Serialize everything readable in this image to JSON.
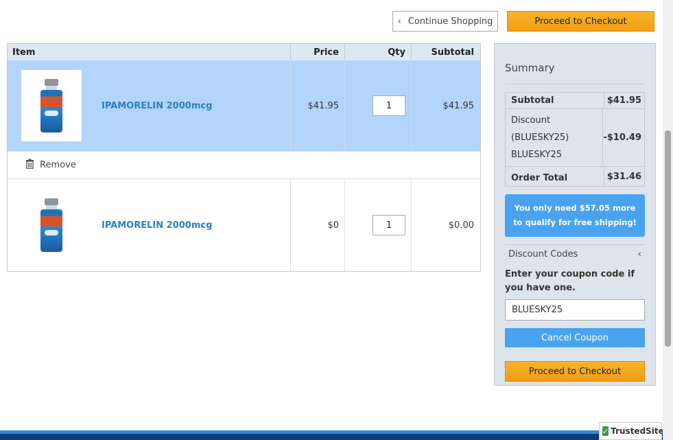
{
  "top": {
    "continue_label": "Continue Shopping",
    "checkout_label": "Proceed to Checkout"
  },
  "cart": {
    "headers": {
      "item": "Item",
      "price": "Price",
      "qty": "Qty",
      "subtotal": "Subtotal"
    },
    "rows": [
      {
        "name": "IPAMORELIN 2000mcg",
        "price": "$41.95",
        "qty": "1",
        "subtotal": "$41.95"
      },
      {
        "name": "IPAMORELIN 2000mcg",
        "price": "$0",
        "qty": "1",
        "subtotal": "$0.00"
      }
    ],
    "remove_label": "Remove"
  },
  "summary": {
    "title": "Summary",
    "subtotal_label": "Subtotal",
    "subtotal_value": "$41.95",
    "discount_label": "Discount (BLUESKY25)",
    "discount_code": "BLUESKY25",
    "discount_value": "-$10.49",
    "order_total_label": "Order Total",
    "order_total_value": "$31.46",
    "shipping_msg": "You only need $57.05 more to qualify for free shipping!",
    "discount_codes_label": "Discount Codes",
    "coupon_hint": "Enter your coupon code if you have one.",
    "coupon_value": "BLUESKY25",
    "cancel_coupon_label": "Cancel Coupon",
    "checkout_label": "Proceed to Checkout"
  },
  "badge": {
    "label": "TrustedSite"
  },
  "colors": {
    "accent_orange": "#f39c12",
    "accent_blue": "#4aa3ee",
    "link_blue": "#2a7fc1",
    "footer": "#0d3b73"
  }
}
